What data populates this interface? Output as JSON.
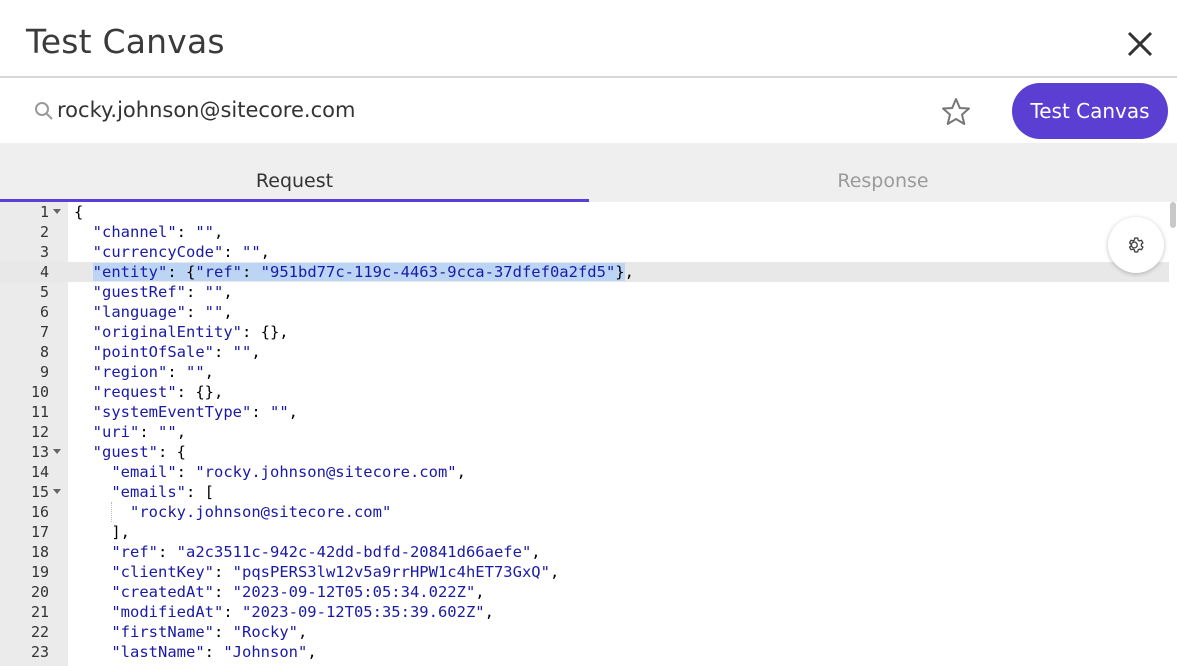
{
  "dialog": {
    "title": "Test Canvas",
    "close_icon": "close-icon"
  },
  "search": {
    "value": "rocky.johnson@sitecore.com",
    "icon": "search-icon"
  },
  "toolbar": {
    "favorite_icon": "star-icon",
    "test_button_label": "Test Canvas",
    "accent_color": "#5b3fd3"
  },
  "tabs": [
    {
      "label": "Request",
      "active": true
    },
    {
      "label": "Response",
      "active": false
    }
  ],
  "editor": {
    "settings_icon": "gear-icon",
    "lines": [
      {
        "n": "1",
        "text": "{"
      },
      {
        "n": "2",
        "text": "  \"channel\": \"\","
      },
      {
        "n": "3",
        "text": "  \"currencyCode\": \"\","
      },
      {
        "n": "4",
        "text": "  \"entity\": {\"ref\": \"951bd77c-119c-4463-9cca-37dfef0a2fd5\"},"
      },
      {
        "n": "5",
        "text": "  \"guestRef\": \"\","
      },
      {
        "n": "6",
        "text": "  \"language\": \"\","
      },
      {
        "n": "7",
        "text": "  \"originalEntity\": {},"
      },
      {
        "n": "8",
        "text": "  \"pointOfSale\": \"\","
      },
      {
        "n": "9",
        "text": "  \"region\": \"\","
      },
      {
        "n": "10",
        "text": "  \"request\": {},"
      },
      {
        "n": "11",
        "text": "  \"systemEventType\": \"\","
      },
      {
        "n": "12",
        "text": "  \"uri\": \"\","
      },
      {
        "n": "13",
        "text": "  \"guest\": {"
      },
      {
        "n": "14",
        "text": "    \"email\": \"rocky.johnson@sitecore.com\","
      },
      {
        "n": "15",
        "text": "    \"emails\": ["
      },
      {
        "n": "16",
        "text": "      \"rocky.johnson@sitecore.com\""
      },
      {
        "n": "17",
        "text": "    ],"
      },
      {
        "n": "18",
        "text": "    \"ref\": \"a2c3511c-942c-42dd-bdfd-20841d66aefe\","
      },
      {
        "n": "19",
        "text": "    \"clientKey\": \"pqsPERS3lw12v5a9rrHPW1c4hET73GxQ\","
      },
      {
        "n": "20",
        "text": "    \"createdAt\": \"2023-09-12T05:05:34.022Z\","
      },
      {
        "n": "21",
        "text": "    \"modifiedAt\": \"2023-09-12T05:35:39.602Z\","
      },
      {
        "n": "22",
        "text": "    \"firstName\": \"Rocky\","
      },
      {
        "n": "23",
        "text": "    \"lastName\": \"Johnson\","
      }
    ]
  }
}
